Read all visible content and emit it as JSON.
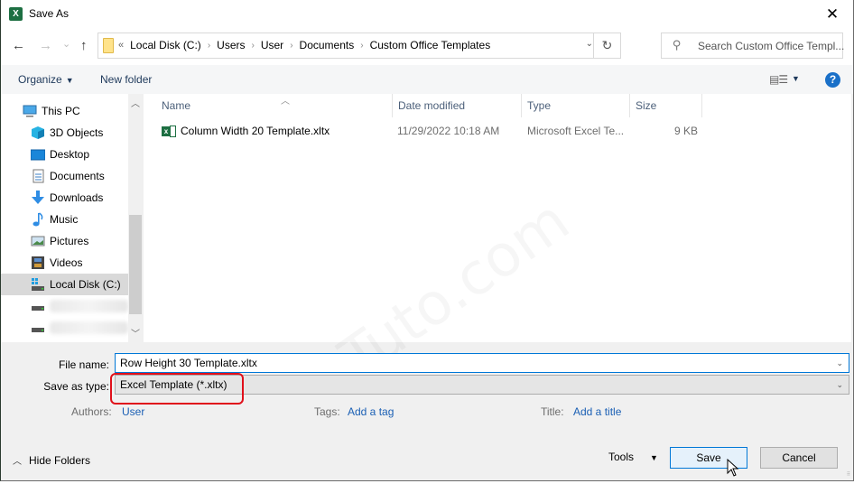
{
  "window": {
    "title": "Save As",
    "app_icon": "excel-icon",
    "close": "✕"
  },
  "nav": {
    "back": "←",
    "forward": "→",
    "recent": "⌄",
    "up": "↑",
    "breadcrumb_overflow": "«",
    "breadcrumbs": [
      "Local Disk (C:)",
      "Users",
      "User",
      "Documents",
      "Custom Office Templates"
    ],
    "separator": "›",
    "refresh": "↻",
    "search_placeholder": "Search Custom Office Templ..."
  },
  "toolbar": {
    "organize": "Organize",
    "new_folder": "New folder",
    "view_icon": "▤☰",
    "help": "?"
  },
  "sidebar": {
    "items": [
      {
        "label": "This PC",
        "icon": "computer-icon"
      },
      {
        "label": "3D Objects",
        "icon": "3d-objects-icon"
      },
      {
        "label": "Desktop",
        "icon": "desktop-icon"
      },
      {
        "label": "Documents",
        "icon": "documents-icon"
      },
      {
        "label": "Downloads",
        "icon": "downloads-icon"
      },
      {
        "label": "Music",
        "icon": "music-icon"
      },
      {
        "label": "Pictures",
        "icon": "pictures-icon"
      },
      {
        "label": "Videos",
        "icon": "videos-icon"
      },
      {
        "label": "Local Disk (C:)",
        "icon": "local-disk-icon",
        "selected": true
      },
      {
        "label": "",
        "icon": "drive-icon",
        "blurred": true
      },
      {
        "label": "",
        "icon": "drive-icon",
        "blurred": true
      }
    ]
  },
  "files": {
    "columns": [
      "Name",
      "Date modified",
      "Type",
      "Size"
    ],
    "rows": [
      {
        "name": "Column Width 20 Template.xltx",
        "date": "11/29/2022 10:18 AM",
        "type": "Microsoft Excel Te...",
        "size": "9 KB"
      }
    ]
  },
  "form": {
    "file_name_label": "File name:",
    "file_name_value": "Row Height 30 Template.xltx",
    "save_type_label": "Save as type:",
    "save_type_value": "Excel Template (*.xltx)",
    "authors_label": "Authors:",
    "authors_value": "User",
    "tags_label": "Tags:",
    "tags_value": "Add a tag",
    "title_label": "Title:",
    "title_value": "Add a title"
  },
  "footer": {
    "hide_folders": "Hide Folders",
    "tools": "Tools",
    "save": "Save",
    "cancel": "Cancel"
  },
  "watermark": "Tuto.com",
  "colors": {
    "accent": "#0078d7",
    "highlight": "#e0101b",
    "link": "#1a5fb4",
    "excel_green": "#1d6f42"
  }
}
